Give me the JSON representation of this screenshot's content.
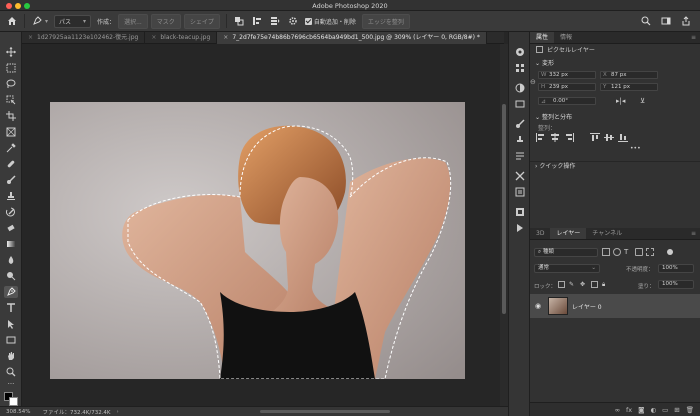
{
  "titlebar": {
    "title": "Adobe Photoshop 2020",
    "traffic_colors": [
      "#ff5f57",
      "#febc2e",
      "#28c840"
    ]
  },
  "options_bar": {
    "mode": "パス",
    "make_label": "作成：",
    "selection_btn": "選択...",
    "mask_btn": "マスク",
    "shape_btn": "シェイプ",
    "auto_add_delete": "自動追加・削除",
    "align_edges": "エッジを整列"
  },
  "doc_tabs": [
    {
      "label": "1d27925aa1123e102462-復元.jpg",
      "active": false
    },
    {
      "label": "black-teacup.jpg",
      "active": false
    },
    {
      "label": "7_2d7fe75e74b86b7696cb6564ba949bd1_500.jpg @ 309% (レイヤー 0, RGB/8#) *",
      "active": true
    }
  ],
  "status": {
    "zoom": "308.54%",
    "file_info": "ファイル：732.4K/732.4K"
  },
  "properties_panel": {
    "tabs": [
      "属性",
      "情報"
    ],
    "pixel_layer": "ピクセルレイヤー",
    "transform_title": "変形",
    "w_label": "W",
    "w_value": "332 px",
    "h_label": "H",
    "h_value": "239 px",
    "x_label": "X",
    "x_value": "87 px",
    "y_label": "Y",
    "y_value": "121 px",
    "angle": "0.00°",
    "align_title": "整列と分布",
    "align_sub": "整列：",
    "more": "•••",
    "quick_actions": "クイック操作"
  },
  "layers_panel": {
    "tabs": [
      "3D",
      "レイヤー",
      "チャンネル"
    ],
    "kind_filter": "種類",
    "blend_mode": "通常",
    "opacity_label": "不透明度：",
    "opacity_value": "100%",
    "lock_label": "ロック：",
    "fill_label": "塗り：",
    "fill_value": "100%",
    "layer_name": "レイヤー 0"
  },
  "colors": {
    "accent": "#ffffff",
    "selection": "#ffffff"
  }
}
